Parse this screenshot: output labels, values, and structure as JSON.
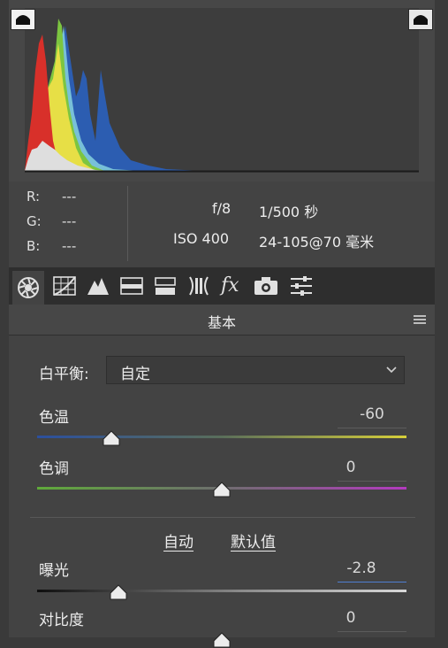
{
  "histogram": {
    "clip_shadow_icon": "shadow-clipping-icon",
    "clip_highlight_icon": "highlight-clipping-icon"
  },
  "readout": {
    "r_label": "R:",
    "r_value": "---",
    "g_label": "G:",
    "g_value": "---",
    "b_label": "B:",
    "b_value": "---"
  },
  "exif": {
    "aperture": "f/8",
    "shutter": "1/500 秒",
    "iso": "ISO 400",
    "lens": "24-105@70 毫米"
  },
  "tabs": [
    {
      "name": "basic",
      "icon": "aperture-icon",
      "active": true
    },
    {
      "name": "tone-curve",
      "icon": "grid-curve-icon"
    },
    {
      "name": "detail",
      "icon": "mountains-icon"
    },
    {
      "name": "hsl",
      "icon": "hsl-icon"
    },
    {
      "name": "split-toning",
      "icon": "split-tone-icon"
    },
    {
      "name": "lens-corrections",
      "icon": "lens-icon"
    },
    {
      "name": "effects",
      "icon": "fx-icon"
    },
    {
      "name": "camera-calibration",
      "icon": "camera-icon"
    },
    {
      "name": "presets",
      "icon": "sliders-icon"
    }
  ],
  "section": {
    "title": "基本"
  },
  "white_balance": {
    "label": "白平衡:",
    "value": "自定"
  },
  "sliders": {
    "temp": {
      "label": "色温",
      "value": "-60",
      "level": 0.2
    },
    "tint": {
      "label": "色调",
      "value": "0",
      "level": 0.5
    },
    "exposure": {
      "label": "曝光",
      "value": "-2.8",
      "level": 0.22
    },
    "contrast": {
      "label": "对比度",
      "value": "0",
      "level": 0.5
    }
  },
  "links": {
    "auto": "自动",
    "default": "默认值"
  },
  "colors": {
    "accent": "#4f7fd1",
    "panel": "#434343",
    "tabbar": "#2e2e2e"
  }
}
